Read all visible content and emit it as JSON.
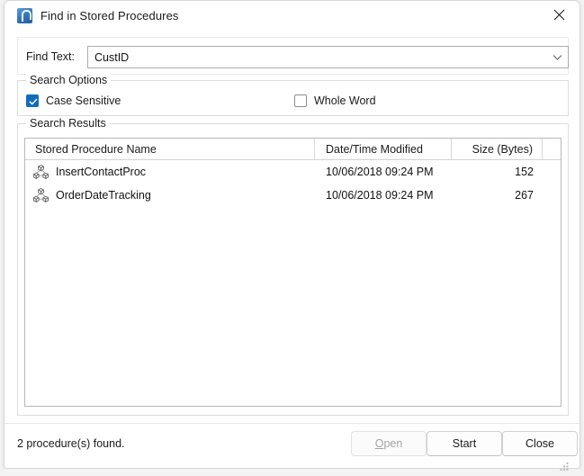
{
  "window": {
    "title": "Find in Stored Procedures",
    "icon": "app-icon",
    "close_icon": "close-icon"
  },
  "find": {
    "label": "Find Text:",
    "value": "CustID",
    "placeholder": "",
    "dropdown_icon": "chevron-down-icon"
  },
  "search_options": {
    "legend": "Search Options",
    "case_sensitive": {
      "label": "Case Sensitive",
      "checked": true
    },
    "whole_word": {
      "label": "Whole Word",
      "checked": false
    }
  },
  "search_results": {
    "legend": "Search Results",
    "columns": [
      "Stored Procedure Name",
      "Date/Time Modified",
      "Size (Bytes)"
    ],
    "rows": [
      {
        "name": "InsertContactProc",
        "modified": "10/06/2018 09:24 PM",
        "size": "152",
        "icon": "stored-procedure-icon"
      },
      {
        "name": "OrderDateTracking",
        "modified": "10/06/2018 09:24 PM",
        "size": "267",
        "icon": "stored-procedure-icon"
      }
    ]
  },
  "footer": {
    "status": "2 procedure(s) found.",
    "buttons": {
      "open": {
        "label": "Open",
        "accel": "O",
        "rest": "pen",
        "disabled": true
      },
      "start": {
        "label": "Start",
        "disabled": false
      },
      "close": {
        "label": "Close",
        "disabled": false
      }
    }
  },
  "colors": {
    "accent": "#0f6cbd",
    "window_bg": "#ffffff",
    "desktop_bg": "#f3f3f3",
    "border": "#b8b8b8"
  }
}
